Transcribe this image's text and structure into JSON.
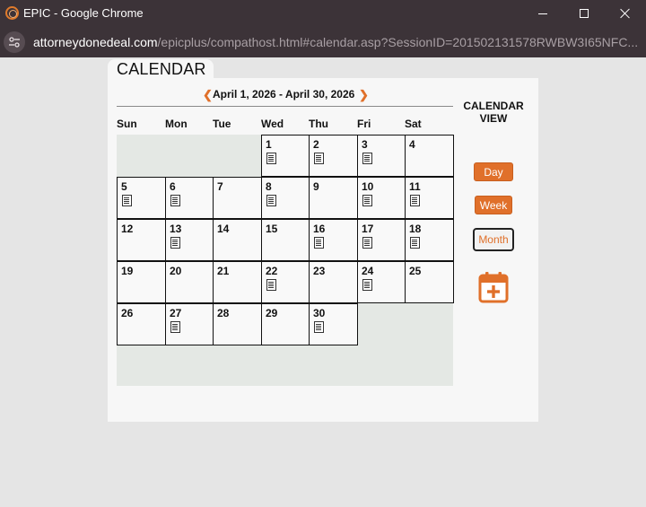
{
  "window": {
    "title": "EPIC - Google Chrome",
    "url_host": "attorneydonedeal.com",
    "url_path": "/epicplus/compathost.html#calendar.asp?SessionID=201502131578RWBW3I65NFC..."
  },
  "page": {
    "tab_title": "CALENDAR",
    "range_label": "April 1, 2026 - April 30, 2026",
    "prev_icon": "chevron-left-icon",
    "next_icon": "chevron-right-icon",
    "weekdays": [
      "Sun",
      "Mon",
      "Tue",
      "Wed",
      "Thu",
      "Fri",
      "Sat"
    ],
    "first_weekday_index": 3,
    "days": [
      {
        "num": "1",
        "doc": true
      },
      {
        "num": "2",
        "doc": true
      },
      {
        "num": "3",
        "doc": true
      },
      {
        "num": "4",
        "doc": false
      },
      {
        "num": "5",
        "doc": true
      },
      {
        "num": "6",
        "doc": true
      },
      {
        "num": "7",
        "doc": false
      },
      {
        "num": "8",
        "doc": true
      },
      {
        "num": "9",
        "doc": false
      },
      {
        "num": "10",
        "doc": true
      },
      {
        "num": "11",
        "doc": true
      },
      {
        "num": "12",
        "doc": false
      },
      {
        "num": "13",
        "doc": true
      },
      {
        "num": "14",
        "doc": false
      },
      {
        "num": "15",
        "doc": false
      },
      {
        "num": "16",
        "doc": true
      },
      {
        "num": "17",
        "doc": true
      },
      {
        "num": "18",
        "doc": true
      },
      {
        "num": "19",
        "doc": false
      },
      {
        "num": "20",
        "doc": false
      },
      {
        "num": "21",
        "doc": false
      },
      {
        "num": "22",
        "doc": true
      },
      {
        "num": "23",
        "doc": false
      },
      {
        "num": "24",
        "doc": true
      },
      {
        "num": "25",
        "doc": false
      },
      {
        "num": "26",
        "doc": false
      },
      {
        "num": "27",
        "doc": true
      },
      {
        "num": "28",
        "doc": false
      },
      {
        "num": "29",
        "doc": false
      },
      {
        "num": "30",
        "doc": true
      }
    ],
    "view_panel": {
      "title": "CALENDAR VIEW",
      "day_label": "Day",
      "week_label": "Week",
      "month_label": "Month",
      "selected_view": "Month",
      "add_icon": "calendar-add-icon"
    }
  },
  "colors": {
    "accent": "#e0702a",
    "titlebar": "#3c3338",
    "grid_empty": "#e4e8e4",
    "cell_bg": "#f9f9f9"
  }
}
